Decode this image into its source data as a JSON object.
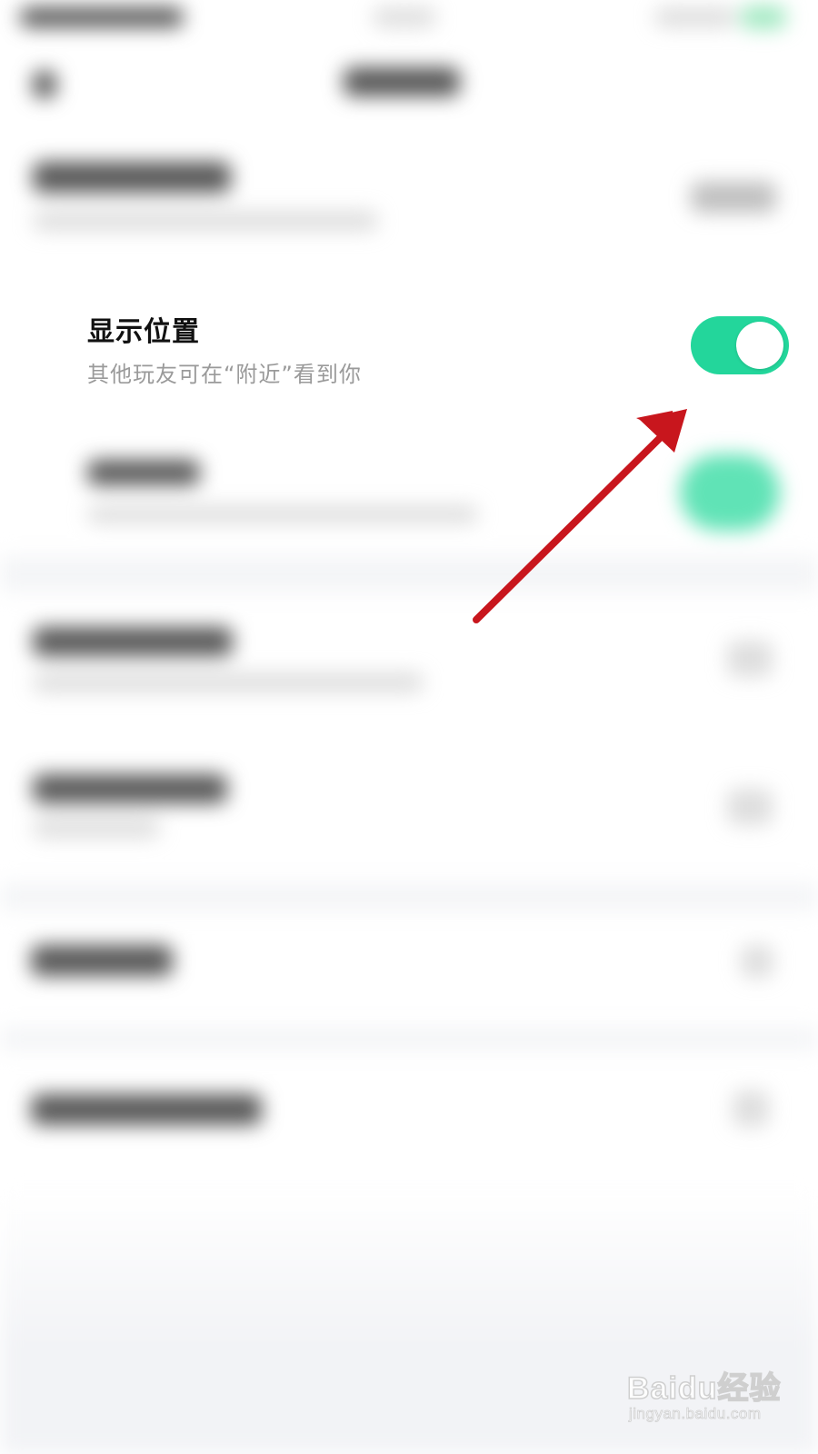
{
  "setting_row": {
    "title": "显示位置",
    "subtitle": "其他玩友可在“附近”看到你",
    "toggle_on": true,
    "toggle_color": "#23d69b"
  },
  "annotation": {
    "arrow_color": "#c8161d"
  },
  "watermark": {
    "logo_text": "Baidu经验",
    "url_text": "jingyan.baidu.com"
  },
  "icons": {
    "toggle": "toggle-switch-on-icon",
    "arrow": "red-arrow-annotation-icon",
    "baidu": "baidu-paw-logo-icon"
  }
}
